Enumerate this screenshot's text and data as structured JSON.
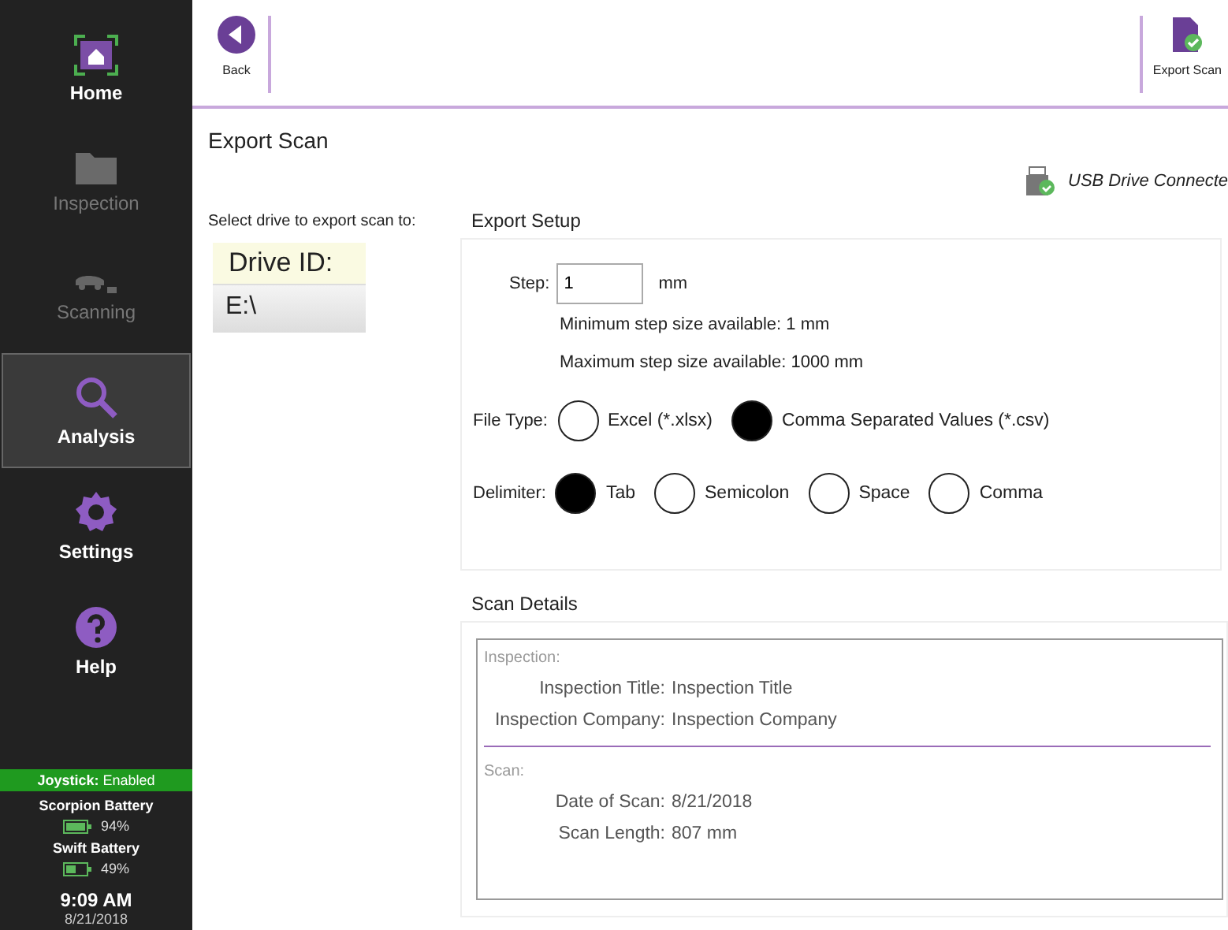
{
  "sidebar": {
    "items": [
      {
        "label": "Home",
        "kind": "home",
        "selected": false,
        "disabled": false
      },
      {
        "label": "Inspection",
        "kind": "folder",
        "selected": false,
        "disabled": true
      },
      {
        "label": "Scanning",
        "kind": "scanner",
        "selected": false,
        "disabled": true
      },
      {
        "label": "Analysis",
        "kind": "search",
        "selected": true,
        "disabled": false
      },
      {
        "label": "Settings",
        "kind": "gear",
        "selected": false,
        "disabled": false
      },
      {
        "label": "Help",
        "kind": "help",
        "selected": false,
        "disabled": false
      }
    ],
    "joystick": {
      "label": "Joystick:",
      "value": "Enabled"
    },
    "batteries": [
      {
        "name": "Scorpion Battery",
        "reading": "94%"
      },
      {
        "name": "Swift Battery",
        "reading": "49%"
      }
    ],
    "time": "9:09 AM",
    "date": "8/21/2018"
  },
  "toolbar": {
    "back": "Back",
    "export": "Export Scan"
  },
  "page": {
    "title": "Export Scan",
    "usb_status": "USB Drive Connecte",
    "drive_prompt": "Select drive to export scan to:",
    "drives": {
      "header": "Drive ID:",
      "rows": [
        "E:\\"
      ]
    }
  },
  "export_setup": {
    "title": "Export Setup",
    "step_label": "Step:",
    "step_value": "1",
    "step_unit": "mm",
    "min_note": "Minimum step size available: 1 mm",
    "max_note": "Maximum step size available: 1000 mm",
    "file_type_label": "File Type:",
    "file_types": [
      {
        "label": "Excel (*.xlsx)",
        "selected": false
      },
      {
        "label": "Comma Separated Values (*.csv)",
        "selected": true
      }
    ],
    "delimiter_label": "Delimiter:",
    "delimiters": [
      {
        "label": "Tab",
        "selected": true
      },
      {
        "label": "Semicolon",
        "selected": false
      },
      {
        "label": "Space",
        "selected": false
      },
      {
        "label": "Comma",
        "selected": false
      }
    ]
  },
  "scan_details": {
    "title": "Scan Details",
    "sections": [
      {
        "heading": "Inspection:",
        "rows": [
          {
            "label": "Inspection Title:",
            "value": "Inspection Title"
          },
          {
            "label": "Inspection Company:",
            "value": "Inspection Company"
          }
        ]
      },
      {
        "heading": "Scan:",
        "rows": [
          {
            "label": "Date of Scan:",
            "value": "8/21/2018"
          },
          {
            "label": "Scan Length:",
            "value": "807 mm"
          }
        ]
      }
    ]
  }
}
